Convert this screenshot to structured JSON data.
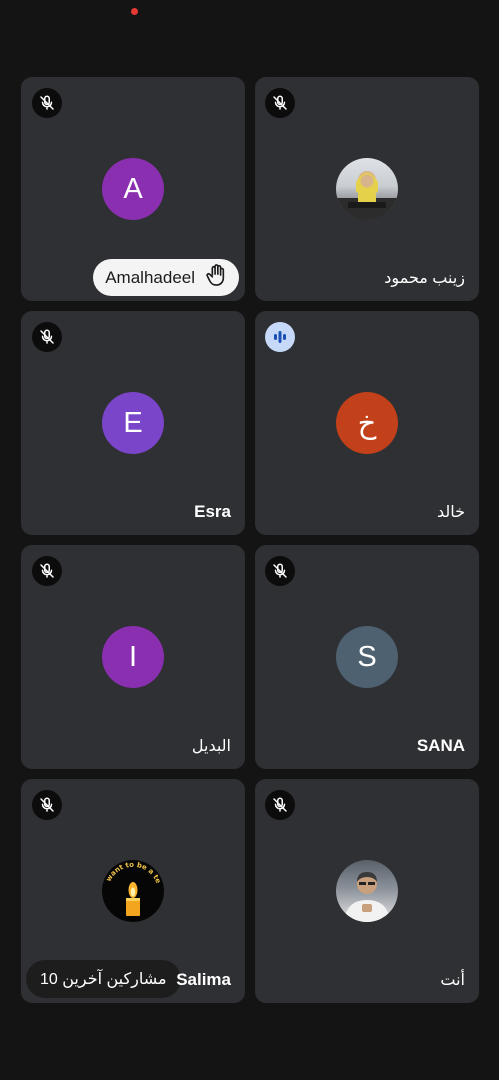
{
  "participants": [
    {
      "name": "Amalhadeel",
      "avatar_letter": "A",
      "avatar_color": "#8a2fb0",
      "mic": "muted",
      "hand_raised": true
    },
    {
      "name": "زينب محمود",
      "avatar_type": "photo",
      "mic": "muted"
    },
    {
      "name": "Esra",
      "avatar_letter": "E",
      "avatar_color": "#7a45c9",
      "mic": "muted"
    },
    {
      "name": "خالد",
      "avatar_letter": "خ",
      "avatar_color": "#c2401a",
      "mic": "speaking"
    },
    {
      "name": "البديل",
      "avatar_letter": "I",
      "avatar_color": "#8a2fb0",
      "mic": "muted"
    },
    {
      "name": "SANA",
      "avatar_letter": "S",
      "avatar_color": "#4e6170",
      "mic": "muted"
    },
    {
      "name": "Salima",
      "avatar_type": "photo",
      "photo_caption": "want to be a teacher",
      "mic": "muted"
    },
    {
      "name": "أنت",
      "avatar_type": "photo",
      "mic": "muted"
    }
  ],
  "others_label": "10 مشاركين آخرين",
  "icons": {
    "mic_muted": "mic-off-icon",
    "speaking": "audio-bars-icon",
    "raised_hand": "raised-hand-icon"
  },
  "colors": {
    "background": "#141414",
    "tile": "#2f3033",
    "speaking_indicator": "#c7d9f8",
    "recording_dot": "#e53935"
  }
}
